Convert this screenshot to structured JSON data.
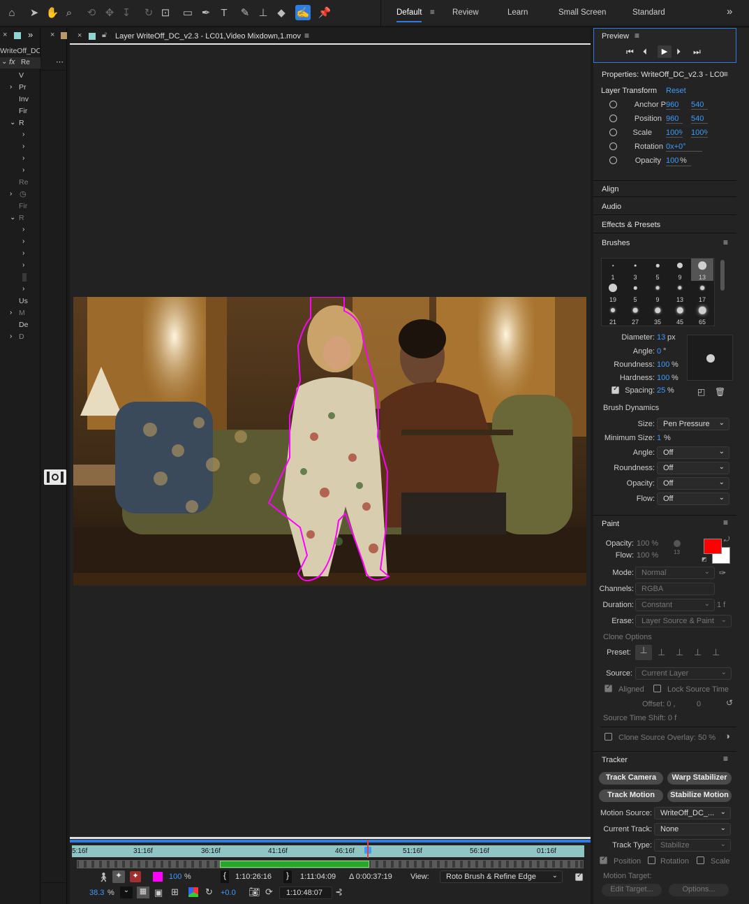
{
  "toolbar": {
    "workspaces": [
      "Default",
      "Review",
      "Learn",
      "Small Screen",
      "Standard"
    ],
    "active_workspace": "Default",
    "more": "»"
  },
  "left_panel": {
    "comp_name": "WriteOff_DC",
    "rows": [
      "Re",
      "V",
      "Pr",
      "Inv",
      "Fir",
      "R",
      "Re",
      "Fir",
      "R",
      "Us",
      "M",
      "De",
      "D"
    ]
  },
  "viewer": {
    "tab_title": "Layer WriteOff_DC_v2.3 - LC01,Video Mixdown,1.mov",
    "ruler_labels": [
      "5:16f",
      "31:16f",
      "36:16f",
      "41:16f",
      "46:16f",
      "51:16f",
      "56:16f",
      "01:16f"
    ],
    "opacity_value": "100",
    "opacity_unit": "%",
    "in_time": "1:10:26:16",
    "out_time": "1:11:04:09",
    "duration": "Δ 0:00:37:19",
    "view_label": "View:",
    "view_value": "Roto Brush & Refine Edge",
    "zoom": "38.3",
    "zoom_unit": "%",
    "exposure": "+0.0",
    "current_time": "1:10:48:07",
    "menu_glyph": "≡"
  },
  "preview": {
    "title": "Preview"
  },
  "properties": {
    "title": "Properties: WriteOff_DC_v2.3 - LC0",
    "layer_transform": "Layer Transform",
    "reset": "Reset",
    "rows": [
      {
        "label": "Anchor P",
        "v1": "960",
        "v2": "540"
      },
      {
        "label": "Position",
        "v1": "960",
        "v2": "540"
      },
      {
        "label": "Scale",
        "v1": "100%",
        "v2": "100%"
      },
      {
        "label": "Rotation",
        "v1": "0x+0°",
        "v2": ""
      },
      {
        "label": "Opacity",
        "v1": "100",
        "v2": "%"
      }
    ]
  },
  "sections": {
    "align": "Align",
    "audio": "Audio",
    "effects": "Effects & Presets",
    "brushes": "Brushes",
    "paint": "Paint",
    "tracker": "Tracker"
  },
  "brushes": {
    "sizes": [
      [
        "1",
        "3",
        "5",
        "9",
        "13"
      ],
      [
        "19",
        "5",
        "9",
        "13",
        "17"
      ],
      [
        "21",
        "27",
        "35",
        "45",
        "65"
      ]
    ],
    "diameter_label": "Diameter:",
    "diameter": "13",
    "diameter_unit": "px",
    "angle_label": "Angle:",
    "angle": "0",
    "angle_unit": "°",
    "roundness_label": "Roundness:",
    "roundness": "100",
    "roundness_unit": "%",
    "hardness_label": "Hardness:",
    "hardness": "100",
    "hardness_unit": "%",
    "spacing_label": "Spacing:",
    "spacing": "25",
    "spacing_unit": "%",
    "dynamics_title": "Brush Dynamics",
    "size_label": "Size:",
    "size": "Pen Pressure",
    "min_size_label": "Minimum Size:",
    "min_size": "1",
    "min_size_unit": "%",
    "d_angle_label": "Angle:",
    "d_angle": "Off",
    "d_roundness_label": "Roundness:",
    "d_roundness": "Off",
    "d_opacity_label": "Opacity:",
    "d_opacity": "Off",
    "d_flow_label": "Flow:",
    "d_flow": "Off"
  },
  "paint": {
    "opacity_label": "Opacity:",
    "opacity": "100 %",
    "flow_label": "Flow:",
    "flow": "100 %",
    "brush_size": "13",
    "fg_color": "#ff0000",
    "bg_color": "#ffffff",
    "mode_label": "Mode:",
    "mode": "Normal",
    "channels_label": "Channels:",
    "channels": "RGBA",
    "duration_label": "Duration:",
    "duration": "Constant",
    "duration_extra": "1 f",
    "erase_label": "Erase:",
    "erase": "Layer Source & Paint",
    "clone_options": "Clone Options",
    "preset_label": "Preset:",
    "source_label": "Source:",
    "source": "Current Layer",
    "aligned": "Aligned",
    "lock_source_time": "Lock Source Time",
    "offset": "Offset: 0 ,          0",
    "source_time_shift": "Source Time Shift: 0  f",
    "clone_overlay": "Clone Source Overlay:",
    "clone_overlay_value": "50 %"
  },
  "tracker": {
    "track_camera": "Track Camera",
    "warp_stabilizer": "Warp Stabilizer",
    "track_motion": "Track Motion",
    "stabilize_motion": "Stabilize Motion",
    "motion_source_label": "Motion Source:",
    "motion_source": "WriteOff_DC_...",
    "current_track_label": "Current Track:",
    "current_track": "None",
    "track_type_label": "Track Type:",
    "track_type": "Stabilize",
    "position": "Position",
    "rotation": "Rotation",
    "scale": "Scale",
    "motion_target": "Motion Target:",
    "edit_target": "Edit Target...",
    "options": "Options..."
  }
}
